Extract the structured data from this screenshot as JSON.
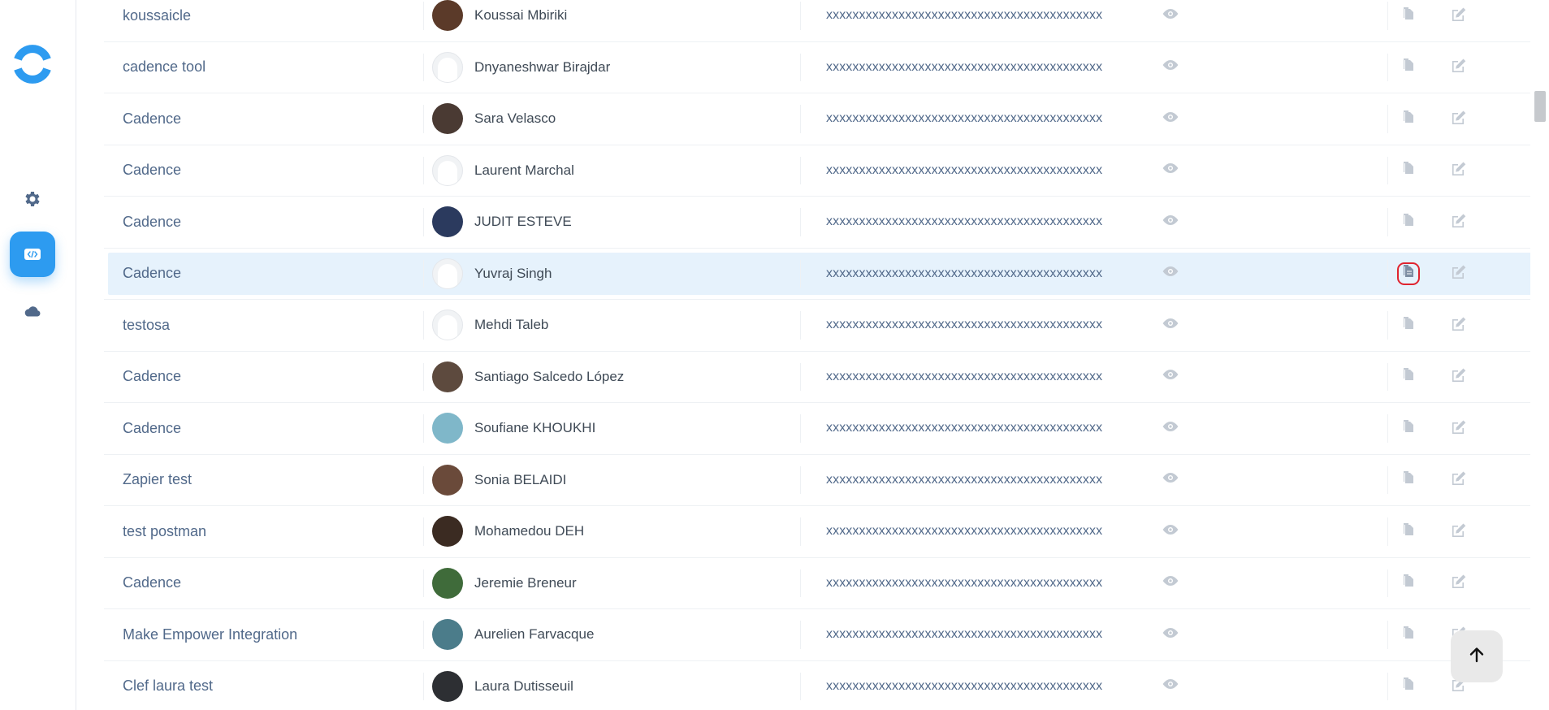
{
  "sidebar": {
    "items": [
      {
        "icon": "gear-icon",
        "active": false
      },
      {
        "icon": "code-icon",
        "active": true
      },
      {
        "icon": "cloud-icon",
        "active": false
      }
    ]
  },
  "table": {
    "rows": [
      {
        "name": "koussaicle",
        "user": "Koussai Mbiriki",
        "key": "xxxxxxxxxxxxxxxxxxxxxxxxxxxxxxxxxxxxxxxxxx"
      },
      {
        "name": "cadence tool",
        "user": "Dnyaneshwar Birajdar",
        "key": "xxxxxxxxxxxxxxxxxxxxxxxxxxxxxxxxxxxxxxxxxx"
      },
      {
        "name": "Cadence",
        "user": "Sara Velasco",
        "key": "xxxxxxxxxxxxxxxxxxxxxxxxxxxxxxxxxxxxxxxxxx"
      },
      {
        "name": "Cadence",
        "user": "Laurent Marchal",
        "key": "xxxxxxxxxxxxxxxxxxxxxxxxxxxxxxxxxxxxxxxxxx"
      },
      {
        "name": "Cadence",
        "user": "JUDIT ESTEVE",
        "key": "xxxxxxxxxxxxxxxxxxxxxxxxxxxxxxxxxxxxxxxxxx"
      },
      {
        "name": "Cadence",
        "user": "Yuvraj Singh",
        "key": "xxxxxxxxxxxxxxxxxxxxxxxxxxxxxxxxxxxxxxxxxx"
      },
      {
        "name": "testosa",
        "user": "Mehdi Taleb",
        "key": "xxxxxxxxxxxxxxxxxxxxxxxxxxxxxxxxxxxxxxxxxx"
      },
      {
        "name": "Cadence",
        "user": "Santiago Salcedo López",
        "key": "xxxxxxxxxxxxxxxxxxxxxxxxxxxxxxxxxxxxxxxxxx"
      },
      {
        "name": "Cadence",
        "user": "Soufiane KHOUKHI",
        "key": "xxxxxxxxxxxxxxxxxxxxxxxxxxxxxxxxxxxxxxxxxx"
      },
      {
        "name": "Zapier test",
        "user": "Sonia BELAIDI",
        "key": "xxxxxxxxxxxxxxxxxxxxxxxxxxxxxxxxxxxxxxxxxx"
      },
      {
        "name": "test postman",
        "user": "Mohamedou DEH",
        "key": "xxxxxxxxxxxxxxxxxxxxxxxxxxxxxxxxxxxxxxxxxx"
      },
      {
        "name": "Cadence",
        "user": "Jeremie Breneur",
        "key": "xxxxxxxxxxxxxxxxxxxxxxxxxxxxxxxxxxxxxxxxxx"
      },
      {
        "name": "Make Empower Integration",
        "user": "Aurelien Farvacque",
        "key": "xxxxxxxxxxxxxxxxxxxxxxxxxxxxxxxxxxxxxxxxxx"
      },
      {
        "name": "Clef laura test",
        "user": "Laura Dutisseuil",
        "key": "xxxxxxxxxxxxxxxxxxxxxxxxxxxxxxxxxxxxxxxxxx"
      }
    ]
  },
  "colors": {
    "accent": "#2d9bf0",
    "text_link": "#51698a",
    "row_highlight": "#e6f2fc",
    "focus_ring": "#e0242f",
    "icon_muted": "#c3cad3"
  }
}
